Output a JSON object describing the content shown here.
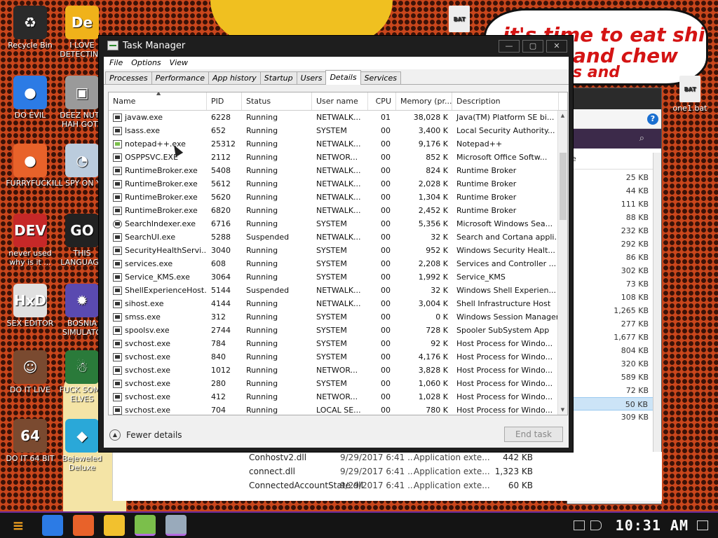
{
  "desktop": {
    "speech_lines": [
      "it's time to eat shit",
      "and chew",
      "s and"
    ],
    "icons": [
      {
        "label": "Recycle Bin",
        "color": "#2a2a2a",
        "glyph": "♻"
      },
      {
        "label": "DO EVIL",
        "color": "#2c7be5",
        "glyph": "●"
      },
      {
        "label": "FURRYFUCK!",
        "color": "#e8622a",
        "glyph": "●"
      },
      {
        "label": "never used why is it ...",
        "color": "#c62828",
        "glyph": "DEV"
      },
      {
        "label": "SEX EDITOR",
        "color": "#e0e0e0",
        "glyph": "HxD"
      },
      {
        "label": "DO IT LIVE",
        "color": "#7a4a30",
        "glyph": "☺"
      },
      {
        "label": "DO IT 64 BIT",
        "color": "#7a4a30",
        "glyph": "64"
      },
      {
        "label": "I LOVE DETECTING",
        "color": "#f0b21a",
        "glyph": "De"
      },
      {
        "label": "DEEZ NUTS HAH GOTT",
        "color": "#9a9a9a",
        "glyph": "▣"
      },
      {
        "label": "ILL SPY ON YOU",
        "color": "#bcd",
        "glyph": "◔"
      },
      {
        "label": "THIS LANGUAGE",
        "color": "#222",
        "glyph": "GO"
      },
      {
        "label": "BOSNIA SIMULATO",
        "color": "#5a4ab0",
        "glyph": "✹"
      },
      {
        "label": "FUCK SOME ELVES",
        "color": "#2a7a3a",
        "glyph": "☃"
      },
      {
        "label": "Bejeweled Deluxe",
        "color": "#2aa8d8",
        "glyph": "◆"
      }
    ],
    "right_icon_label": "one1.bat",
    "bat_label": "BAT"
  },
  "explorer": {
    "sizes": [
      "25 KB",
      "44 KB",
      "111 KB",
      "88 KB",
      "232 KB",
      "292 KB",
      "86 KB",
      "302 KB",
      "73 KB",
      "108 KB",
      "1,265 KB",
      "277 KB",
      "1,677 KB",
      "804 KB",
      "320 KB",
      "589 KB",
      "72 KB",
      "50 KB",
      "309 KB"
    ],
    "header_col": "e",
    "bottom_rows": [
      {
        "name": "Conhostv2.dll",
        "date": "9/29/2017 6:41 ...",
        "type": "Application exte...",
        "size": "442 KB"
      },
      {
        "name": "connect.dll",
        "date": "9/29/2017 6:41 ...",
        "type": "Application exte...",
        "size": "1,323 KB"
      },
      {
        "name": "ConnectedAccountState.dll",
        "date": "9/29/2017 6:41 ...",
        "type": "Application exte...",
        "size": "60 KB"
      }
    ]
  },
  "taskmgr": {
    "title": "Task Manager",
    "window_buttons": [
      "—",
      "▢",
      "✕"
    ],
    "menu": [
      "File",
      "Options",
      "View"
    ],
    "tabs": [
      "Processes",
      "Performance",
      "App history",
      "Startup",
      "Users",
      "Details",
      "Services"
    ],
    "active_tab": "Details",
    "columns": [
      "Name",
      "PID",
      "Status",
      "User name",
      "CPU",
      "Memory (pr...",
      "Description"
    ],
    "rows": [
      {
        "name": "javaw.exe",
        "pid": "6228",
        "status": "Running",
        "user": "NETWALK...",
        "cpu": "01",
        "mem": "38,028 K",
        "desc": "Java(TM) Platform SE bi..."
      },
      {
        "name": "lsass.exe",
        "pid": "652",
        "status": "Running",
        "user": "SYSTEM",
        "cpu": "00",
        "mem": "3,400 K",
        "desc": "Local Security Authority..."
      },
      {
        "name": "notepad++.exe",
        "pid": "25312",
        "status": "Running",
        "user": "NETWALK...",
        "cpu": "00",
        "mem": "9,176 K",
        "desc": "Notepad++"
      },
      {
        "name": "OSPPSVC.EXE",
        "pid": "2112",
        "status": "Running",
        "user": "NETWOR...",
        "cpu": "00",
        "mem": "852 K",
        "desc": "Microsoft Office Softw..."
      },
      {
        "name": "RuntimeBroker.exe",
        "pid": "5408",
        "status": "Running",
        "user": "NETWALK...",
        "cpu": "00",
        "mem": "824 K",
        "desc": "Runtime Broker"
      },
      {
        "name": "RuntimeBroker.exe",
        "pid": "5612",
        "status": "Running",
        "user": "NETWALK...",
        "cpu": "00",
        "mem": "2,028 K",
        "desc": "Runtime Broker"
      },
      {
        "name": "RuntimeBroker.exe",
        "pid": "5620",
        "status": "Running",
        "user": "NETWALK...",
        "cpu": "00",
        "mem": "1,304 K",
        "desc": "Runtime Broker"
      },
      {
        "name": "RuntimeBroker.exe",
        "pid": "6820",
        "status": "Running",
        "user": "NETWALK...",
        "cpu": "00",
        "mem": "2,452 K",
        "desc": "Runtime Broker"
      },
      {
        "name": "SearchIndexer.exe",
        "pid": "6716",
        "status": "Running",
        "user": "SYSTEM",
        "cpu": "00",
        "mem": "5,356 K",
        "desc": "Microsoft Windows Sea..."
      },
      {
        "name": "SearchUI.exe",
        "pid": "5288",
        "status": "Suspended",
        "user": "NETWALK...",
        "cpu": "00",
        "mem": "32 K",
        "desc": "Search and Cortana appli..."
      },
      {
        "name": "SecurityHealthServi...",
        "pid": "3040",
        "status": "Running",
        "user": "SYSTEM",
        "cpu": "00",
        "mem": "952 K",
        "desc": "Windows Security Healt..."
      },
      {
        "name": "services.exe",
        "pid": "608",
        "status": "Running",
        "user": "SYSTEM",
        "cpu": "00",
        "mem": "2,208 K",
        "desc": "Services and Controller ..."
      },
      {
        "name": "Service_KMS.exe",
        "pid": "3064",
        "status": "Running",
        "user": "SYSTEM",
        "cpu": "00",
        "mem": "1,992 K",
        "desc": "Service_KMS"
      },
      {
        "name": "ShellExperienceHost...",
        "pid": "5144",
        "status": "Suspended",
        "user": "NETWALK...",
        "cpu": "00",
        "mem": "32 K",
        "desc": "Windows Shell Experien..."
      },
      {
        "name": "sihost.exe",
        "pid": "4144",
        "status": "Running",
        "user": "NETWALK...",
        "cpu": "00",
        "mem": "3,004 K",
        "desc": "Shell Infrastructure Host"
      },
      {
        "name": "smss.exe",
        "pid": "312",
        "status": "Running",
        "user": "SYSTEM",
        "cpu": "00",
        "mem": "0 K",
        "desc": "Windows Session Manager"
      },
      {
        "name": "spoolsv.exe",
        "pid": "2744",
        "status": "Running",
        "user": "SYSTEM",
        "cpu": "00",
        "mem": "728 K",
        "desc": "Spooler SubSystem App"
      },
      {
        "name": "svchost.exe",
        "pid": "784",
        "status": "Running",
        "user": "SYSTEM",
        "cpu": "00",
        "mem": "92 K",
        "desc": "Host Process for Windo..."
      },
      {
        "name": "svchost.exe",
        "pid": "840",
        "status": "Running",
        "user": "SYSTEM",
        "cpu": "00",
        "mem": "4,176 K",
        "desc": "Host Process for Windo..."
      },
      {
        "name": "svchost.exe",
        "pid": "1012",
        "status": "Running",
        "user": "NETWOR...",
        "cpu": "00",
        "mem": "3,828 K",
        "desc": "Host Process for Windo..."
      },
      {
        "name": "svchost.exe",
        "pid": "280",
        "status": "Running",
        "user": "SYSTEM",
        "cpu": "00",
        "mem": "1,060 K",
        "desc": "Host Process for Windo..."
      },
      {
        "name": "svchost.exe",
        "pid": "412",
        "status": "Running",
        "user": "NETWOR...",
        "cpu": "00",
        "mem": "1,028 K",
        "desc": "Host Process for Windo..."
      },
      {
        "name": "svchost.exe",
        "pid": "704",
        "status": "Running",
        "user": "LOCAL SE...",
        "cpu": "00",
        "mem": "780 K",
        "desc": "Host Process for Windo..."
      }
    ],
    "fewer_details": "Fewer details",
    "end_task": "End task"
  },
  "taskbar": {
    "start_glyph": "≡",
    "apps": [
      {
        "name": "chrome",
        "color": "#2c7be5"
      },
      {
        "name": "firefox",
        "color": "#e8622a"
      },
      {
        "name": "file-explorer",
        "color": "#f2c12e"
      },
      {
        "name": "notepad-plus-plus",
        "color": "#7bbf4b"
      },
      {
        "name": "task-manager",
        "color": "#9ab"
      }
    ],
    "clock": "10:31 AM"
  }
}
